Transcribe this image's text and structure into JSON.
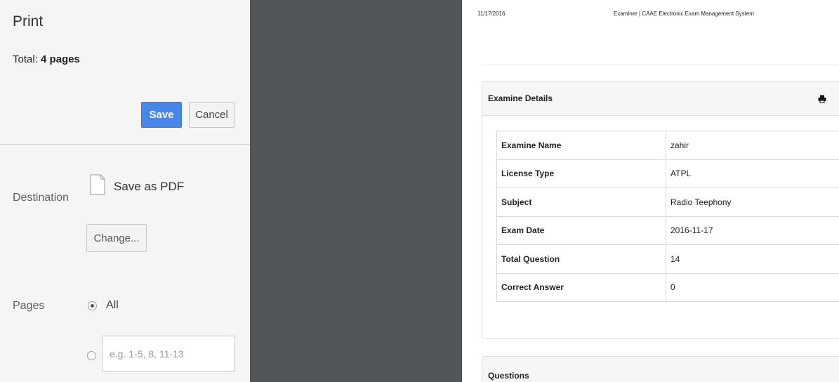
{
  "sidebar": {
    "title": "Print",
    "total_prefix": "Total: ",
    "total_pages": "4 pages",
    "save_label": "Save",
    "cancel_label": "Cancel",
    "destination": {
      "label": "Destination",
      "value": "Save as PDF",
      "change_label": "Change..."
    },
    "pages": {
      "label": "Pages",
      "all_label": "All",
      "range_placeholder": "e.g. 1-5, 8, 11-13",
      "selected": "All"
    }
  },
  "preview": {
    "date": "11/17/2016",
    "header": "Examiner | CAAE Electronic Exam Management System",
    "section_title": "Examine Details",
    "details": [
      {
        "key": "Examine Name",
        "value": "zahir"
      },
      {
        "key": "License Type",
        "value": "ATPL"
      },
      {
        "key": "Subject",
        "value": "Radio Teephony"
      },
      {
        "key": "Exam Date",
        "value": "2016-11-17"
      },
      {
        "key": "Total Question",
        "value": "14"
      },
      {
        "key": "Correct Answer",
        "value": "0"
      }
    ],
    "questions_title": "Questions"
  },
  "colors": {
    "accent": "#4a86e8",
    "preview_background": "#525659",
    "sidebar_background": "#f5f5f5"
  },
  "icons": [
    "file-icon",
    "print-icon"
  ]
}
